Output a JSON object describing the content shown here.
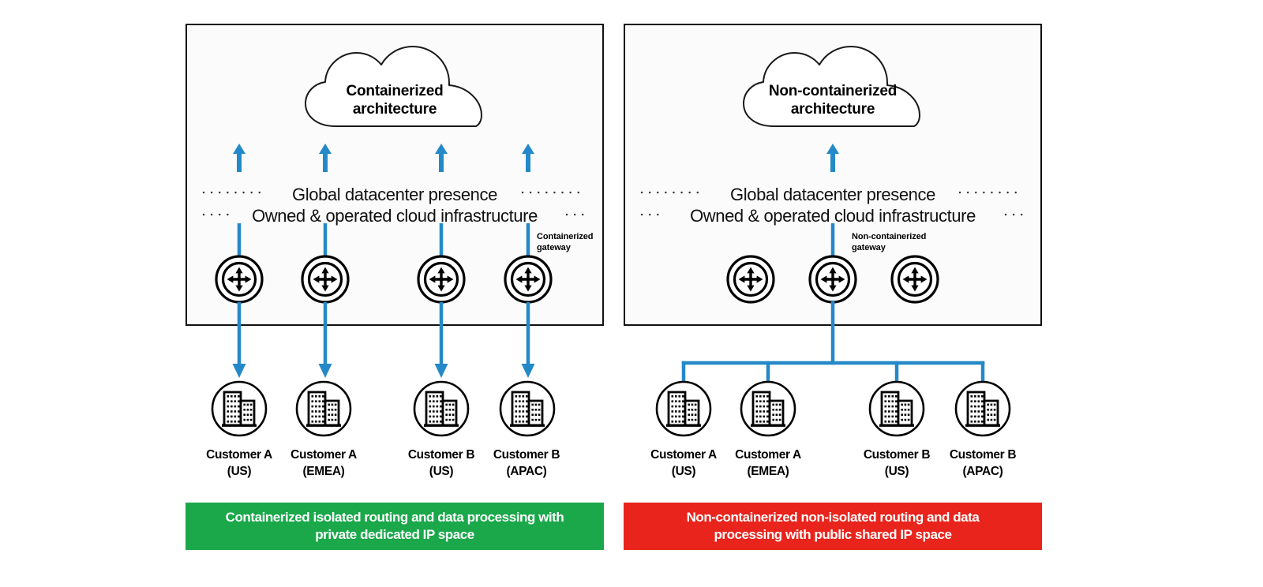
{
  "palette": {
    "arrow_blue": "#2489c8",
    "panel_border": "#111111",
    "panel_bg": "#fbfbfb",
    "green": "#1aa84a",
    "red": "#e8241c",
    "ink": "#000000"
  },
  "panels": [
    {
      "id": "left",
      "cloud_label_line1": "Containerized",
      "cloud_label_line2": "architecture",
      "infra_line1": "Global datacenter presence",
      "infra_line2": "Owned & operated cloud infrastructure",
      "gateway_label_line1": "Containerized",
      "gateway_label_line2": "gateway",
      "routers": 4,
      "up_arrows": 4,
      "topology": "isolated",
      "customers": [
        {
          "name": "Customer A",
          "region": "(US)"
        },
        {
          "name": "Customer A",
          "region": "(EMEA)"
        },
        {
          "name": "Customer B",
          "region": "(US)"
        },
        {
          "name": "Customer B",
          "region": "(APAC)"
        }
      ],
      "banner_line1": "Containerized isolated routing and data processing with",
      "banner_line2": "private dedicated IP space",
      "banner_color": "#1aa84a"
    },
    {
      "id": "right",
      "cloud_label_line1": "Non-containerized",
      "cloud_label_line2": "architecture",
      "infra_line1": "Global datacenter presence",
      "infra_line2": "Owned & operated cloud infrastructure",
      "gateway_label_line1": "Non-containerized",
      "gateway_label_line2": "gateway",
      "routers": 3,
      "up_arrows": 1,
      "topology": "shared-bus",
      "customers": [
        {
          "name": "Customer A",
          "region": "(US)"
        },
        {
          "name": "Customer A",
          "region": "(EMEA)"
        },
        {
          "name": "Customer B",
          "region": "(US)"
        },
        {
          "name": "Customer B",
          "region": "(APAC)"
        }
      ],
      "banner_line1": "Non-containerized non-isolated routing and data",
      "banner_line2": "processing with public shared IP space",
      "banner_color": "#e8241c"
    }
  ],
  "icons": {
    "cloud": "cloud-icon",
    "router": "router-icon",
    "building": "office-building-icon",
    "arrow_up": "arrow-up-icon",
    "arrow_down": "arrow-down-icon"
  }
}
